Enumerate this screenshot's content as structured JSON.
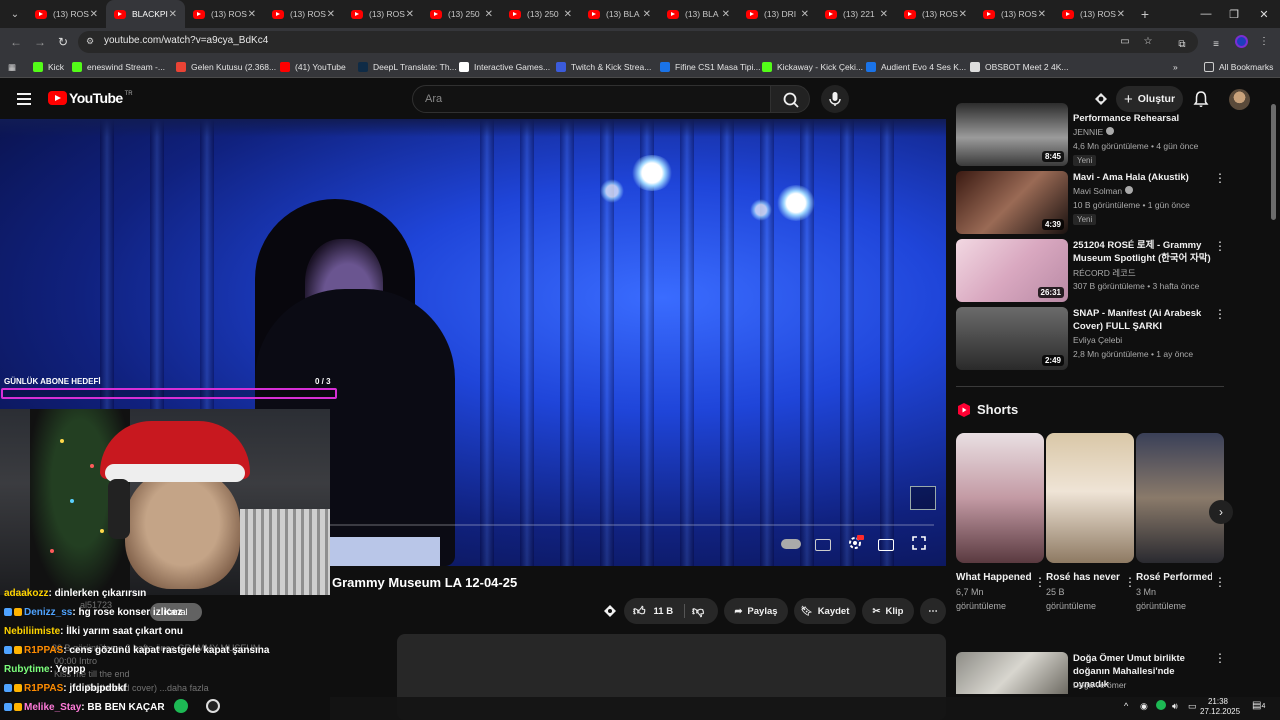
{
  "browser": {
    "tabs": [
      {
        "title": "(13) ROS",
        "active": false
      },
      {
        "title": "BLACKPI",
        "active": true
      },
      {
        "title": "(13) ROS",
        "active": false
      },
      {
        "title": "(13) ROS",
        "active": false
      },
      {
        "title": "(13) ROS",
        "active": false
      },
      {
        "title": "(13) 250",
        "active": false
      },
      {
        "title": "(13) 250",
        "active": false
      },
      {
        "title": "(13) BLA",
        "active": false
      },
      {
        "title": "(13) BLA",
        "active": false
      },
      {
        "title": "(13) DRI",
        "active": false
      },
      {
        "title": "(13) 221",
        "active": false
      },
      {
        "title": "(13) ROS",
        "active": false
      },
      {
        "title": "(13) ROS",
        "active": false
      },
      {
        "title": "(13) ROS",
        "active": false
      }
    ],
    "url": "youtube.com/watch?v=a9cya_BdKc4",
    "bookmarks": [
      {
        "label": "Kick",
        "icon": "kick-icon",
        "color": "#53fc18"
      },
      {
        "label": "eneswind Stream -...",
        "icon": "kick-icon",
        "color": "#53fc18"
      },
      {
        "label": "Gelen Kutusu (2.368...",
        "icon": "gmail-icon",
        "color": "#ea4335"
      },
      {
        "label": "(41) YouTube",
        "icon": "youtube-icon",
        "color": "#ff0000"
      },
      {
        "label": "DeepL Translate: Th...",
        "icon": "deepl-icon",
        "color": "#0f2b46"
      },
      {
        "label": "Interactive Games...",
        "icon": "page-icon",
        "color": "#ffffff"
      },
      {
        "label": "Twitch & Kick Strea...",
        "icon": "cp-icon",
        "color": "#3b5bdb"
      },
      {
        "label": "Fifine CS1 Masa Tipi...",
        "icon": "check-icon",
        "color": "#1a73e8"
      },
      {
        "label": "Kickaway - Kick Çeki...",
        "icon": "kickaway-icon",
        "color": "#53fc18"
      },
      {
        "label": "Audient Evo 4 Ses K...",
        "icon": "check-icon",
        "color": "#1a73e8"
      },
      {
        "label": "OBSBOT Meet 2 4K...",
        "icon": "obsbot-icon",
        "color": "#dddddd"
      }
    ],
    "all_bookmarks": "All Bookmarks"
  },
  "youtube": {
    "logo_text": "YouTube",
    "logo_region": "TR",
    "search_placeholder": "Ara",
    "create_label": "Oluştur",
    "video": {
      "title": "Grammy Museum LA 12-04-25",
      "likes": "11 B",
      "share": "Paylaş",
      "save": "Kaydet",
      "clip": "Klip"
    },
    "recommendations": [
      {
        "title": "Performance Rehearsal",
        "channel": "JENNIE",
        "meta": "4,6 Mn görüntüleme • 4 gün önce",
        "duration": "8:45",
        "new": "Yeni",
        "verified": true
      },
      {
        "title": "Mavi - Ama Hala (Akustik)",
        "channel": "Mavi Solman",
        "meta": "10 B görüntüleme • 1 gün önce",
        "duration": "4:39",
        "new": "Yeni",
        "verified": true
      },
      {
        "title": "251204 ROSÉ 로제 - Grammy Museum Spotlight (한국어 자막)",
        "channel": "RÉCORD 레코드",
        "meta": "307 B görüntüleme • 3 hafta önce",
        "duration": "26:31",
        "new": "",
        "verified": false
      },
      {
        "title": "SNAP - Manifest (Ai Arabesk Cover) FULL ŞARKI",
        "channel": "Evliya Çelebi",
        "meta": "2,8 Mn görüntüleme • 1 ay önce",
        "duration": "2:49",
        "new": "",
        "verified": false
      }
    ],
    "shorts_heading": "Shorts",
    "shorts": [
      {
        "title": "What Happened t...",
        "views": "6,7 Mn",
        "views_unit": "görüntüleme"
      },
      {
        "title": "Rosé has never tried ...",
        "views": "25 B",
        "views_unit": "görüntüleme"
      },
      {
        "title": "Rosé Performed ...",
        "views": "3 Mn",
        "views_unit": "görüntüleme"
      }
    ],
    "bottom_rec": {
      "title": "Doğa Ömer Umut birlikte doğanın Mahallesi'nde oynadık",
      "channel": "Doğa ve ömer"
    }
  },
  "stream_overlay": {
    "goal_label": "GÜNLÜK ABONE HEDEFİ",
    "goal_count": "0  / 3",
    "goal_progress": 0,
    "chat": [
      {
        "user": "adaakozz",
        "color": "#ffd400",
        "msg": ": dinlerken çıkarırsın"
      },
      {
        "user": "Denizz_ss",
        "color": "#4fa3ff",
        "msg": ": hg rose konser izlicez"
      },
      {
        "user": "Nebiliimiste",
        "color": "#ffd400",
        "msg": ": İlki yarım saat çıkart onu"
      },
      {
        "user": "R1PPAS",
        "color": "#ff8c00",
        "msg": ": cens gözünü kapat rastgele kapat şansına"
      },
      {
        "user": "Rubytime",
        "color": "#7cff7c",
        "msg": ": Yeppp"
      },
      {
        "user": "R1PPAS",
        "color": "#ff8c00",
        "msg": ": jfdipbjpdbkf"
      },
      {
        "user": "Melike_Stay",
        "color": "#ff7ad9",
        "msg": ": BB BEN KAÇAR"
      }
    ],
    "ghost_texts": [
      "al51723",
      "Kanal",
      "al51723",
      "30 B görüntüleme  3 hafta önce  GRAMMY MUSEUM",
      "00:00 Intro",
      "Kiss me till the end",
      "Radiohead cover)  ...daha fazla"
    ]
  },
  "taskbar": {
    "time": "21:38",
    "date": "27.12.2025",
    "notifications": "4"
  }
}
